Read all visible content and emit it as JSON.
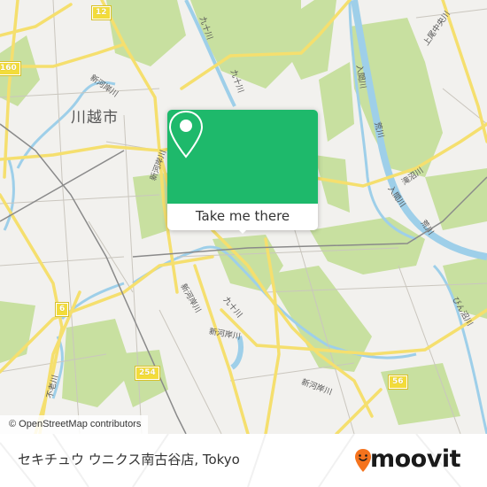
{
  "map": {
    "city_label": "川越市",
    "route_shields": [
      "12",
      "160",
      "6",
      "254",
      "56"
    ],
    "river_labels": [
      "新河岸川",
      "九十川",
      "九十川",
      "九十川",
      "入間川",
      "荒川",
      "上尾中央川",
      "滝沼川",
      "入間川",
      "荒川",
      "荒川",
      "新河岸川",
      "新河岸川",
      "九十川",
      "新河岸川",
      "不老川",
      "びん沼川",
      "新河岸川"
    ],
    "attribution": "© OpenStreetMap contributors",
    "colors": {
      "background": "#f2f1ee",
      "park": "#c5df9a",
      "water": "#9ecfe9",
      "major_road": "#f5df6e",
      "minor_road": "#c9c6c0",
      "rail": "#888888"
    }
  },
  "popup": {
    "icon": "map-pin-icon",
    "cta_label": "Take me there",
    "accent_color": "#1eb96b"
  },
  "footer": {
    "place_name": "セキチュウ ウニクス南古谷店, Tokyo",
    "brand": "moovit",
    "brand_icon": "moovit-smiley-pin-icon",
    "brand_color": "#f5731d"
  }
}
